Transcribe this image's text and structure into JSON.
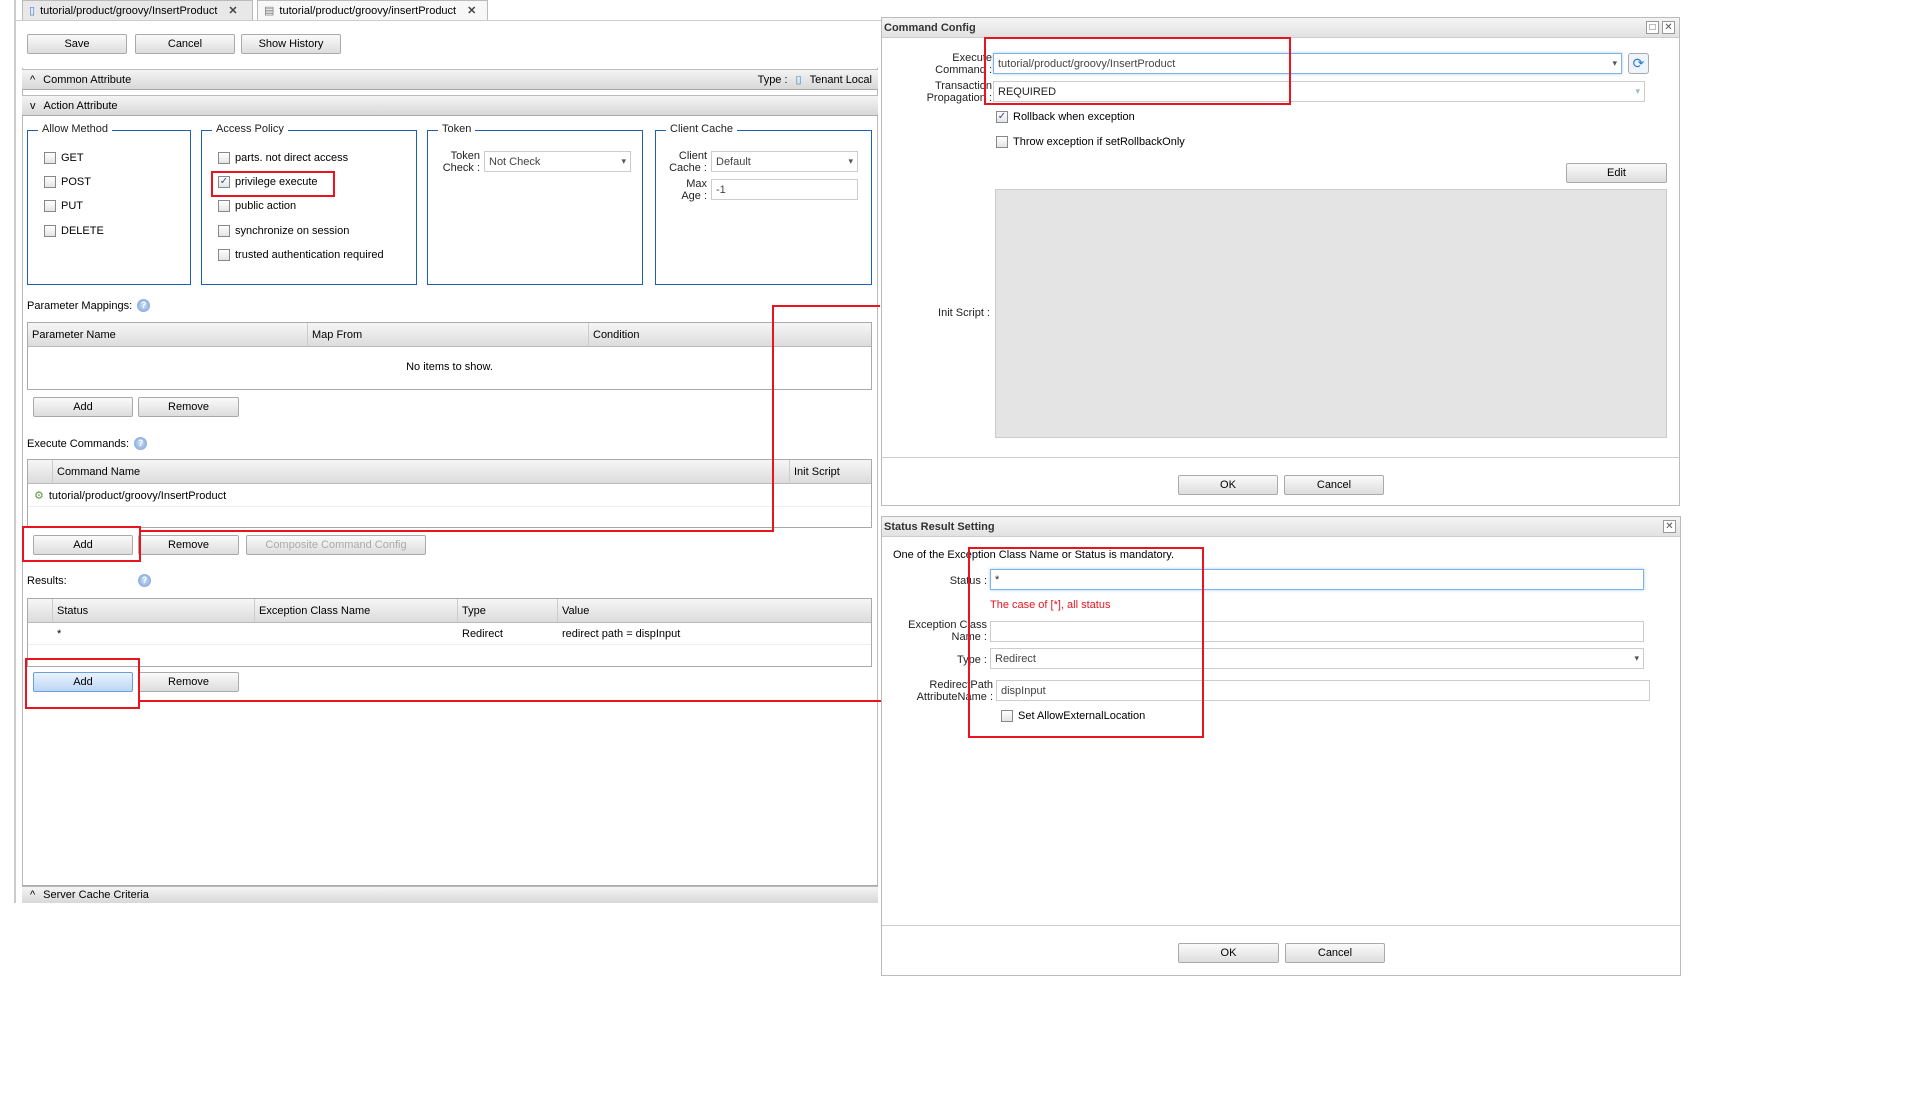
{
  "tabs": [
    {
      "label": "tutorial/product/groovy/InsertProduct"
    },
    {
      "label": "tutorial/product/groovy/insertProduct"
    }
  ],
  "toolbar": {
    "save": "Save",
    "cancel": "Cancel",
    "show_history": "Show History"
  },
  "common_attribute": {
    "title": "Common Attribute",
    "type_label": "Type :",
    "type_value": "Tenant Local"
  },
  "action_attribute": {
    "title": "Action Attribute",
    "allow_method": {
      "legend": "Allow Method",
      "items": [
        {
          "label": "GET",
          "checked": false
        },
        {
          "label": "POST",
          "checked": false
        },
        {
          "label": "PUT",
          "checked": false
        },
        {
          "label": "DELETE",
          "checked": false
        }
      ]
    },
    "access_policy": {
      "legend": "Access Policy",
      "items": [
        {
          "label": "parts. not direct access",
          "checked": false
        },
        {
          "label": "privilege execute",
          "checked": true
        },
        {
          "label": "public action",
          "checked": false
        },
        {
          "label": "synchronize on session",
          "checked": false
        },
        {
          "label": "trusted authentication required",
          "checked": false
        }
      ]
    },
    "token": {
      "legend": "Token",
      "label_1": "Token",
      "label_2": "Check :",
      "value": "Not Check"
    },
    "client_cache": {
      "legend": "Client Cache",
      "cache_label_1": "Client",
      "cache_label_2": "Cache :",
      "cache_value": "Default",
      "max_label_1": "Max",
      "max_label_2": "Age :",
      "max_value": "-1"
    }
  },
  "parameter_mappings": {
    "label": "Parameter Mappings:",
    "columns": [
      "Parameter Name",
      "Map From",
      "Condition"
    ],
    "empty": "No items to show.",
    "add": "Add",
    "remove": "Remove"
  },
  "execute_commands": {
    "label": "Execute Commands:",
    "columns": [
      "Command Name",
      "Init Script"
    ],
    "rows": [
      {
        "command": "tutorial/product/groovy/InsertProduct",
        "init_script": ""
      }
    ],
    "add": "Add",
    "remove": "Remove",
    "composite": "Composite Command Config"
  },
  "results": {
    "label": "Results:",
    "columns": [
      "Status",
      "Exception Class Name",
      "Type",
      "Value"
    ],
    "rows": [
      {
        "status": "*",
        "exception": "",
        "type": "Redirect",
        "value": "redirect path = dispInput"
      }
    ],
    "add": "Add",
    "remove": "Remove"
  },
  "server_cache": {
    "title": "Server Cache Criteria"
  },
  "command_config": {
    "title": "Command Config",
    "execute_label_1": "Execute",
    "execute_label_2": "Command :",
    "execute_value": "tutorial/product/groovy/InsertProduct",
    "tx_label_1": "Transaction",
    "tx_label_2": "Propagation :",
    "tx_value": "REQUIRED",
    "rollback": {
      "label": "Rollback when exception",
      "checked": true
    },
    "throw": {
      "label": "Throw exception if setRollbackOnly",
      "checked": false
    },
    "edit": "Edit",
    "init_script_label": "Init Script :",
    "ok": "OK",
    "cancel": "Cancel"
  },
  "status_result": {
    "title": "Status Result Setting",
    "note": "One of the Exception Class Name or Status is mandatory.",
    "status_label": "Status :",
    "status_value": "*",
    "hint": "The case of [*], all status",
    "exception_label_1": "Exception Class",
    "exception_label_2": "Name :",
    "exception_value": "",
    "type_label": "Type :",
    "type_value": "Redirect",
    "redirect_label_1": "RedirectPath",
    "redirect_label_2": "AttributeName :",
    "redirect_value": "dispInput",
    "allow_external": {
      "label": "Set AllowExternalLocation",
      "checked": false
    },
    "ok": "OK",
    "cancel": "Cancel"
  },
  "colors": {
    "highlight": "#e8141f",
    "fieldset_border": "#1d5fb0",
    "hint_text": "#e8141f"
  }
}
